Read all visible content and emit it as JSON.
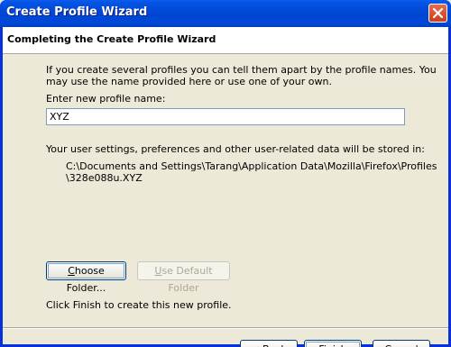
{
  "window": {
    "title": "Create Profile Wizard",
    "colors": {
      "titlebar": "#0047d6",
      "close_button": "#c8401c",
      "face": "#ece9d8"
    }
  },
  "header": {
    "title": "Completing the Create Profile Wizard"
  },
  "intro": {
    "line1": "If you create several profiles you can tell them apart by the profile names. You",
    "line2": "may use the name provided here or use one of your own."
  },
  "profile_name": {
    "label": "Enter new profile name:",
    "value": "XYZ"
  },
  "storage": {
    "label": "Your user settings, preferences and other user-related data will be stored in:",
    "path_line1": "C:\\Documents and Settings\\Tarang\\Application Data\\Mozilla\\Firefox\\Profiles",
    "path_line2": "\\328e088u.XYZ"
  },
  "buttons": {
    "choose_folder": {
      "accel": "C",
      "rest": "hoose Folder..."
    },
    "use_default_folder": {
      "accel": "U",
      "rest": "se Default Folder",
      "disabled": true
    },
    "back": {
      "prefix": "< ",
      "accel": "B",
      "rest": "ack"
    },
    "finish": {
      "label": "Finish"
    },
    "cancel": {
      "label": "Cancel"
    }
  },
  "finish_note": "Click Finish to create this new profile.",
  "icons": {
    "close": "close-icon"
  }
}
